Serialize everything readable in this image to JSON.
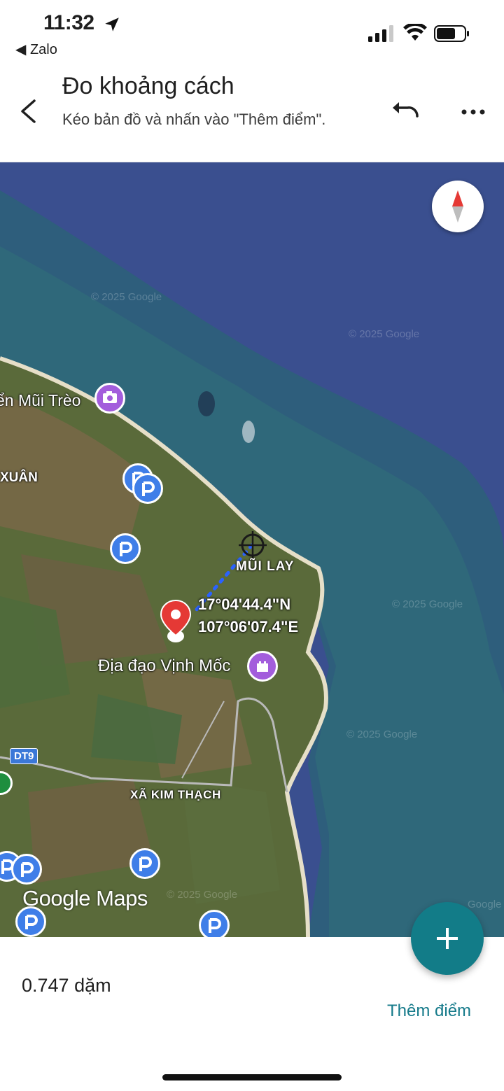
{
  "status_bar": {
    "time": "11:32",
    "back_app": "◀ Zalo"
  },
  "header": {
    "title": "Đo khoảng cách",
    "subtitle": "Kéo bản đồ và nhấn vào \"Thêm điểm\"."
  },
  "map": {
    "watermarks": [
      "© 2025 Google",
      "© 2025 Google",
      "© 2025 Google",
      "© 2025 Google",
      "© 2025 Google",
      "Google"
    ],
    "labels": {
      "mui_treo": "ển Mũi Trèo",
      "xuan": "XUÂN",
      "mui_lay": "MŨI LAY",
      "dia_dao": "Địa đạo Vịnh Mốc",
      "kim_thach": "XÃ KIM THẠCH",
      "route": "DT9"
    },
    "coordinates": {
      "lat": "17°04'44.4\"N",
      "lng": "107°06'07.4\"E"
    },
    "logo": "Google Maps"
  },
  "bottom": {
    "distance": "0.747 dặm",
    "add_point": "Thêm điểm"
  },
  "colors": {
    "accent": "#127c88",
    "link": "#157a8a",
    "poi_blue": "#3f7ee8",
    "poi_purple": "#a35ddc",
    "pin_red": "#e53935"
  }
}
